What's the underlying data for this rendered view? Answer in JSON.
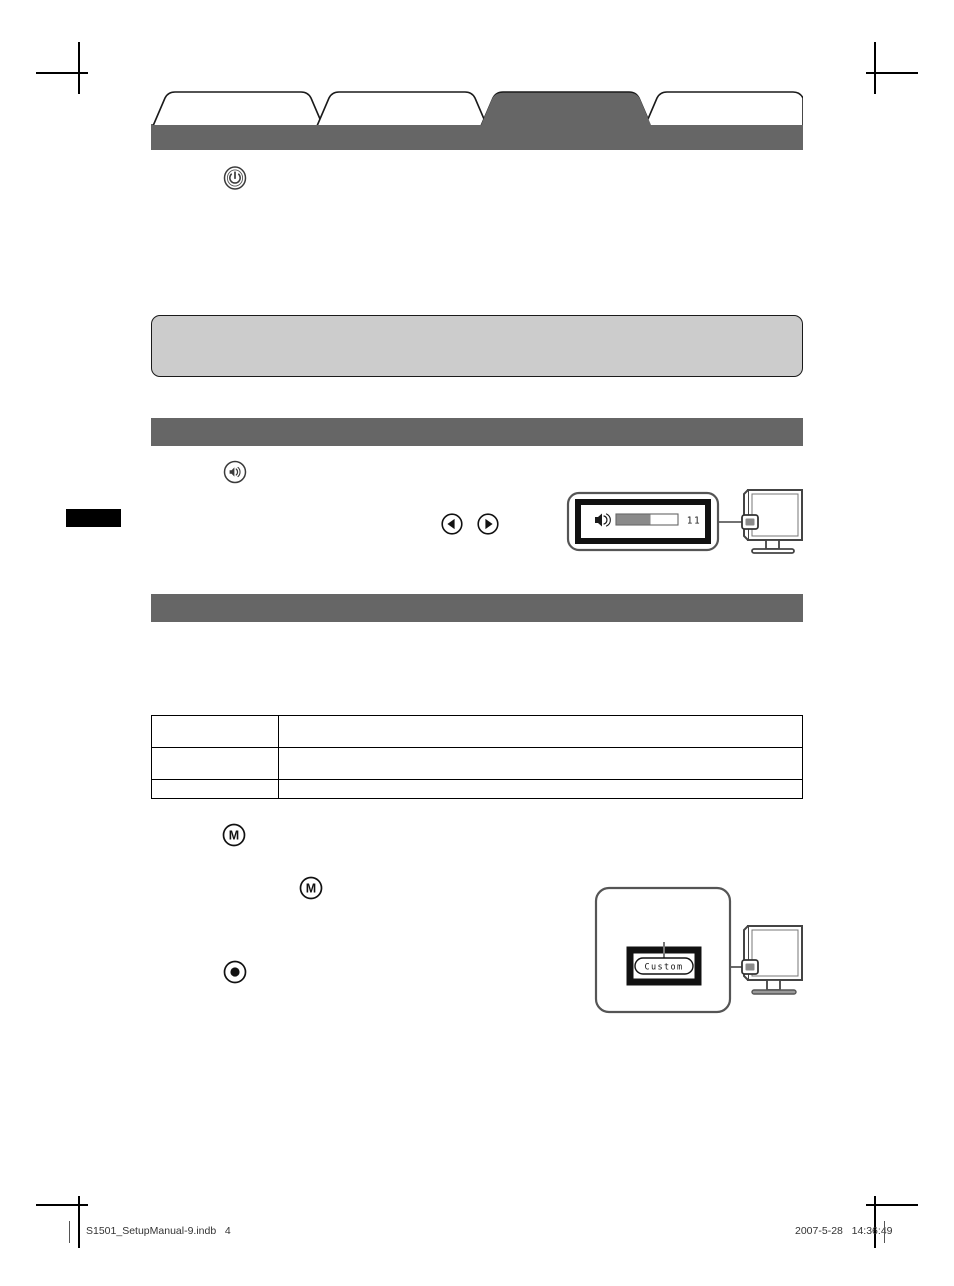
{
  "document": {
    "page_number": "4",
    "kind": "printed-setup-manual-page"
  },
  "crop_marks": {
    "present": true,
    "corners": [
      "top-left",
      "top-right",
      "bottom-left",
      "bottom-right"
    ]
  },
  "edge_tab": {
    "name": "thumb-index-tab",
    "color": "#000000"
  },
  "chapter_tabs": {
    "active_index": 2,
    "active_color": "#666666",
    "inactive_color": "#ffffff",
    "outline_color": "#1a1a1a",
    "items": [
      {
        "label": ""
      },
      {
        "label": ""
      },
      {
        "label": ""
      },
      {
        "label": ""
      }
    ]
  },
  "sections": [
    {
      "name": "power-section",
      "heading": "",
      "bar_color": "#666666",
      "icons": [
        {
          "name": "power-button-icon",
          "glyph": "power"
        }
      ]
    },
    {
      "name": "volume-section",
      "heading": "",
      "bar_color": "#666666",
      "icons": [
        {
          "name": "volume-button-icon",
          "glyph": "speaker"
        },
        {
          "name": "left-arrow-button-icon",
          "glyph": "arrow-left"
        },
        {
          "name": "right-arrow-button-icon",
          "glyph": "arrow-right"
        }
      ]
    },
    {
      "name": "fine-contrast-section",
      "heading": "",
      "bar_color": "#666666",
      "icons": [
        {
          "name": "mode-button-icon",
          "glyph": "M"
        },
        {
          "name": "mode-button-icon-inline",
          "glyph": "M"
        },
        {
          "name": "enter-button-icon",
          "glyph": "enter-dot"
        }
      ]
    }
  ],
  "note_box": {
    "name": "attention-note-box",
    "text": "",
    "fill": "#cccccc",
    "border": "#1a1a1a"
  },
  "spec_table": {
    "columns": [
      "",
      ""
    ],
    "rows": [
      {
        "label": "",
        "value": ""
      },
      {
        "label": "",
        "value": ""
      },
      {
        "label": "",
        "value": ""
      }
    ]
  },
  "illustrations": [
    {
      "name": "volume-osd-illustration",
      "osd_type": "volume-bar",
      "icon": "speaker",
      "value": "11",
      "bar_fill_percent": 55,
      "monitor": {
        "name": "monitor-front-view",
        "highlight": "osd-button"
      }
    },
    {
      "name": "fine-contrast-osd-illustration",
      "osd_type": "mode-name",
      "value": "Custom",
      "monitor": {
        "name": "monitor-front-view",
        "highlight": "mode-button"
      }
    }
  ],
  "footer": {
    "left": "S1501_SetupManual-9.indb   4",
    "right": "2007-5-28   14:36:49"
  }
}
